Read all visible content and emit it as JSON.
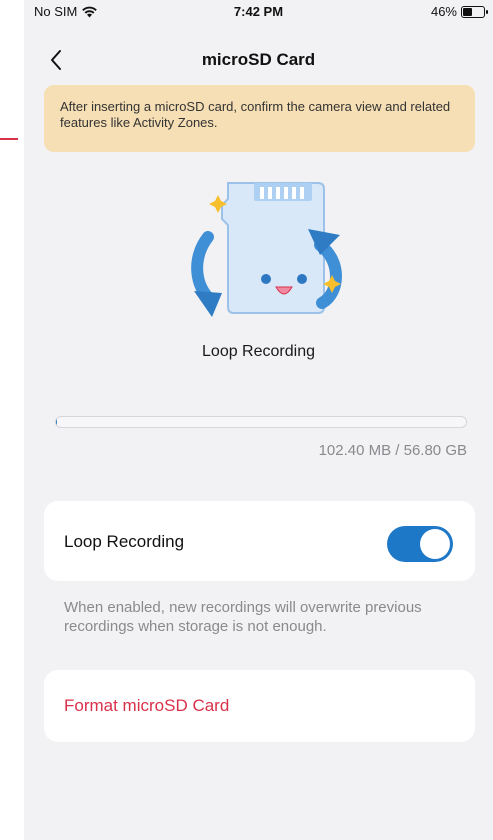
{
  "status_bar": {
    "carrier": "No SIM",
    "time": "7:42 PM",
    "battery": "46%",
    "battery_level": 0.46
  },
  "nav": {
    "title": "microSD Card",
    "back_icon": "chevron-left-icon"
  },
  "banner": {
    "text": "After inserting a microSD card, confirm the camera view and related features like Activity Zones."
  },
  "illustration": {
    "label": "Loop Recording",
    "icon": "sd-card-loop-icon"
  },
  "storage": {
    "used_text": "102.40 MB / 56.80 GB",
    "used_fraction": 0.0018
  },
  "loop_recording": {
    "label": "Loop Recording",
    "enabled": true,
    "hint": "When enabled, new recordings will overwrite previous recordings when storage is not enough."
  },
  "format": {
    "label": "Format microSD Card"
  },
  "colors": {
    "accent": "#1e78c8",
    "danger": "#d9314a",
    "banner_bg": "#f6dfb4",
    "page_bg": "#f2f2f4"
  }
}
